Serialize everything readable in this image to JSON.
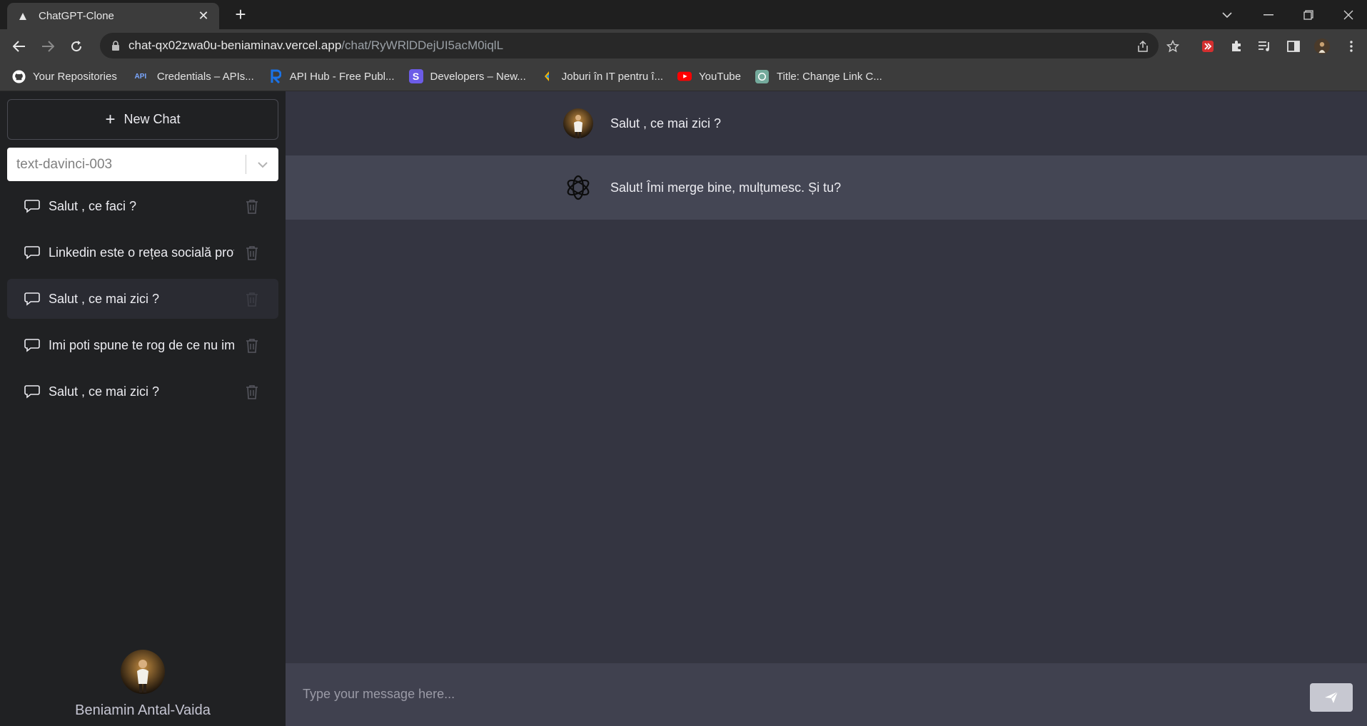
{
  "browser": {
    "tab_title": "ChatGPT-Clone",
    "new_tab_symbol": "+",
    "url_host": "chat-qx02zwa0u-beniaminav.vercel.app",
    "url_path": "/chat/RyWRlDDejUI5acM0iqlL",
    "bookmarks": [
      {
        "label": "Your Repositories",
        "icon": "github-icon"
      },
      {
        "label": "Credentials – APIs...",
        "icon": "api-icon",
        "badge": "API"
      },
      {
        "label": "API Hub - Free Publ...",
        "icon": "rapidapi-icon"
      },
      {
        "label": "Developers – New...",
        "icon": "s-logo-icon",
        "badge": "S"
      },
      {
        "label": "Joburi în IT pentru î...",
        "icon": "jobs-icon"
      },
      {
        "label": "YouTube",
        "icon": "youtube-icon"
      },
      {
        "label": "Title: Change Link C...",
        "icon": "openai-icon"
      }
    ]
  },
  "sidebar": {
    "new_chat_label": "New Chat",
    "new_chat_symbol": "+",
    "model_select": {
      "value": "text-davinci-003"
    },
    "chats": [
      {
        "label": "Salut , ce faci ?",
        "active": false
      },
      {
        "label": "Linkedin este o rețea socială profe",
        "active": false
      },
      {
        "label": "Salut , ce mai zici ?",
        "active": true
      },
      {
        "label": "Imi poti spune te rog de ce nu imi",
        "active": false
      },
      {
        "label": "Salut , ce mai zici ?",
        "active": false
      }
    ],
    "user_name": "Beniamin Antal-Vaida"
  },
  "conversation": {
    "messages": [
      {
        "role": "user",
        "text": "Salut , ce mai zici ?"
      },
      {
        "role": "assistant",
        "text": "Salut! Îmi merge bine, mulțumesc. Și tu?"
      }
    ]
  },
  "composer": {
    "placeholder": "Type your message here...",
    "value": ""
  },
  "colors": {
    "sidebar_bg": "#202123",
    "main_bg": "#343541",
    "assistant_bg": "#444654",
    "composer_bg": "#40414f"
  }
}
